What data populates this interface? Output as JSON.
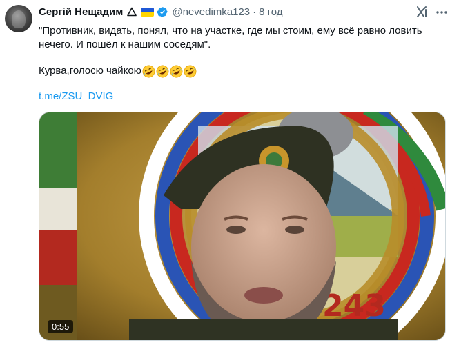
{
  "author": {
    "display_name": "Сергій Нещадим",
    "handle": "@nevedimka123",
    "separator": "·",
    "time_ago": "8 год",
    "avatar_icon": "user-avatar",
    "badges": [
      "delta-icon",
      "ukraine-flag-icon",
      "verified-badge-icon"
    ]
  },
  "tweet": {
    "quote_line1": "\"Противник, видать, понял, что на участке, где мы стоим, ему всё равно ловить",
    "quote_line2": "нечего. И пошёл к нашим соседям\".",
    "comment": "Курва,голосю чайкою",
    "comment_emoji": "rolling-on-floor-laughing-emoji",
    "comment_emoji_count": 4,
    "link": "t.me/ZSU_DVIG"
  },
  "header_icons": [
    "grok-icon",
    "more-options-icon"
  ],
  "media": {
    "type": "video",
    "duration": "0:55",
    "description_icon": "video-thumbnail"
  },
  "colors": {
    "text": "#0f1419",
    "secondary": "#536471",
    "link": "#1d9bf0",
    "verified": "#1d9bf0",
    "flag_blue": "#1f58d6",
    "flag_yellow": "#ffd500"
  }
}
